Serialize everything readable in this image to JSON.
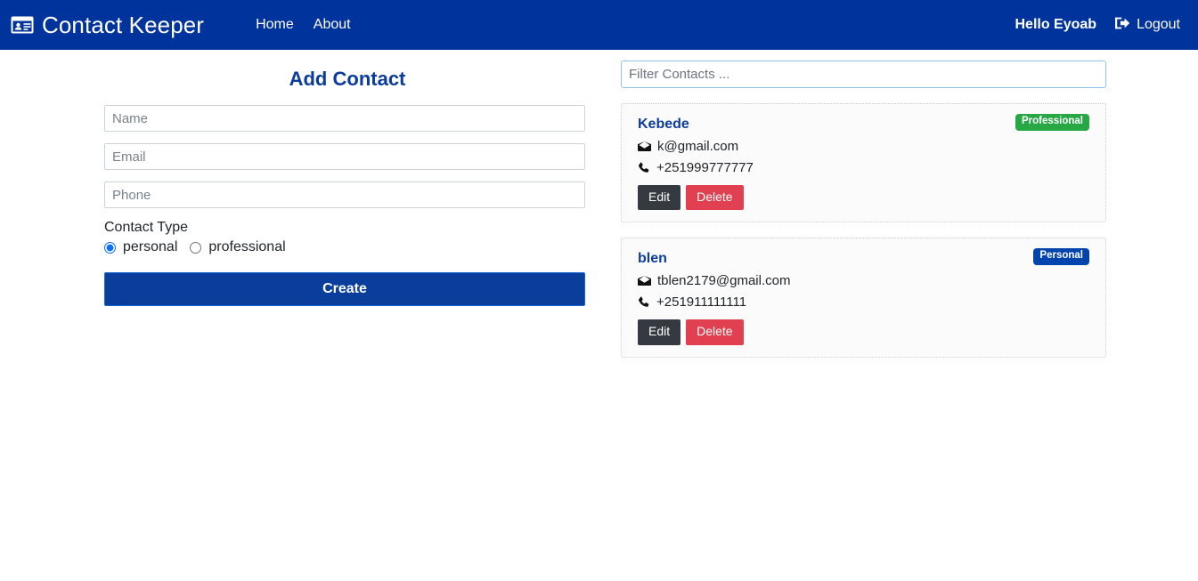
{
  "navbar": {
    "brand": "Contact Keeper",
    "brand_icon": "id-card-icon",
    "links": [
      {
        "label": "Home",
        "name": "nav-link-home"
      },
      {
        "label": "About",
        "name": "nav-link-about"
      }
    ],
    "greeting": "Hello Eyoab",
    "logout_label": "Logout",
    "logout_icon": "sign-out-icon",
    "background_color": "#00339b"
  },
  "form": {
    "title": "Add Contact",
    "name_placeholder": "Name",
    "name_value": "",
    "email_placeholder": "Email",
    "email_value": "",
    "phone_placeholder": "Phone",
    "phone_value": "",
    "contact_type_label": "Contact Type",
    "type_options": [
      {
        "label": "personal",
        "value": "personal",
        "checked": true
      },
      {
        "label": "professional",
        "value": "professional",
        "checked": false
      }
    ],
    "submit_label": "Create",
    "submit_color": "#0a3d9c"
  },
  "filter": {
    "placeholder": "Filter Contacts ...",
    "value": ""
  },
  "contacts": [
    {
      "name": "Kebede",
      "email": "k@gmail.com",
      "phone": "+251999777777",
      "badge": "Professional",
      "badge_color": "#28a745",
      "edit_label": "Edit",
      "delete_label": "Delete"
    },
    {
      "name": "blen",
      "email": "tblen2179@gmail.com",
      "phone": "+251911111111",
      "badge": "Personal",
      "badge_color": "#0044ad",
      "edit_label": "Edit",
      "delete_label": "Delete"
    }
  ]
}
